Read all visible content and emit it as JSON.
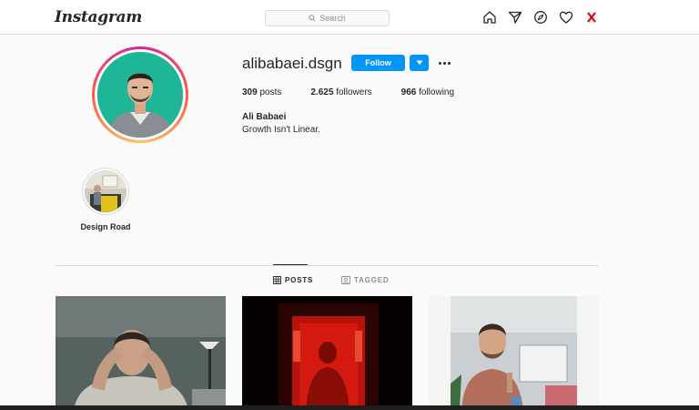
{
  "app": {
    "logo": "Instagram"
  },
  "search": {
    "placeholder": "Search"
  },
  "nav": {
    "icons": [
      "home-icon",
      "direct-icon",
      "explore-icon",
      "activity-heart-icon",
      "profile-avatar"
    ]
  },
  "profile": {
    "username": "alibabaei.dsgn",
    "follow_label": "Follow",
    "posts_count": "309",
    "posts_label": "posts",
    "followers_count": "2.625",
    "followers_label": "followers",
    "following_count": "966",
    "following_label": "following",
    "full_name": "Ali Babaei",
    "bio": "Growth Isn't Linear."
  },
  "highlights": [
    {
      "label": "Design Road"
    }
  ],
  "tabs": {
    "posts": "POSTS",
    "tagged": "TAGGED",
    "active": "posts"
  },
  "colors": {
    "accent": "#0095f6",
    "text": "#262626",
    "muted": "#8e8e8e",
    "border": "#dbdbdb"
  }
}
